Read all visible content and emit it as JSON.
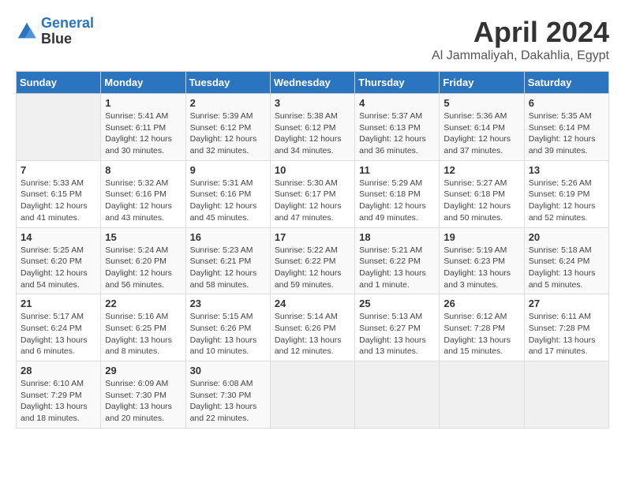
{
  "logo": {
    "line1": "General",
    "line2": "Blue"
  },
  "title": "April 2024",
  "subtitle": "Al Jammaliyah, Dakahlia, Egypt",
  "headers": [
    "Sunday",
    "Monday",
    "Tuesday",
    "Wednesday",
    "Thursday",
    "Friday",
    "Saturday"
  ],
  "weeks": [
    [
      {
        "num": "",
        "detail": ""
      },
      {
        "num": "1",
        "detail": "Sunrise: 5:41 AM\nSunset: 6:11 PM\nDaylight: 12 hours\nand 30 minutes."
      },
      {
        "num": "2",
        "detail": "Sunrise: 5:39 AM\nSunset: 6:12 PM\nDaylight: 12 hours\nand 32 minutes."
      },
      {
        "num": "3",
        "detail": "Sunrise: 5:38 AM\nSunset: 6:12 PM\nDaylight: 12 hours\nand 34 minutes."
      },
      {
        "num": "4",
        "detail": "Sunrise: 5:37 AM\nSunset: 6:13 PM\nDaylight: 12 hours\nand 36 minutes."
      },
      {
        "num": "5",
        "detail": "Sunrise: 5:36 AM\nSunset: 6:14 PM\nDaylight: 12 hours\nand 37 minutes."
      },
      {
        "num": "6",
        "detail": "Sunrise: 5:35 AM\nSunset: 6:14 PM\nDaylight: 12 hours\nand 39 minutes."
      }
    ],
    [
      {
        "num": "7",
        "detail": "Sunrise: 5:33 AM\nSunset: 6:15 PM\nDaylight: 12 hours\nand 41 minutes."
      },
      {
        "num": "8",
        "detail": "Sunrise: 5:32 AM\nSunset: 6:16 PM\nDaylight: 12 hours\nand 43 minutes."
      },
      {
        "num": "9",
        "detail": "Sunrise: 5:31 AM\nSunset: 6:16 PM\nDaylight: 12 hours\nand 45 minutes."
      },
      {
        "num": "10",
        "detail": "Sunrise: 5:30 AM\nSunset: 6:17 PM\nDaylight: 12 hours\nand 47 minutes."
      },
      {
        "num": "11",
        "detail": "Sunrise: 5:29 AM\nSunset: 6:18 PM\nDaylight: 12 hours\nand 49 minutes."
      },
      {
        "num": "12",
        "detail": "Sunrise: 5:27 AM\nSunset: 6:18 PM\nDaylight: 12 hours\nand 50 minutes."
      },
      {
        "num": "13",
        "detail": "Sunrise: 5:26 AM\nSunset: 6:19 PM\nDaylight: 12 hours\nand 52 minutes."
      }
    ],
    [
      {
        "num": "14",
        "detail": "Sunrise: 5:25 AM\nSunset: 6:20 PM\nDaylight: 12 hours\nand 54 minutes."
      },
      {
        "num": "15",
        "detail": "Sunrise: 5:24 AM\nSunset: 6:20 PM\nDaylight: 12 hours\nand 56 minutes."
      },
      {
        "num": "16",
        "detail": "Sunrise: 5:23 AM\nSunset: 6:21 PM\nDaylight: 12 hours\nand 58 minutes."
      },
      {
        "num": "17",
        "detail": "Sunrise: 5:22 AM\nSunset: 6:22 PM\nDaylight: 12 hours\nand 59 minutes."
      },
      {
        "num": "18",
        "detail": "Sunrise: 5:21 AM\nSunset: 6:22 PM\nDaylight: 13 hours\nand 1 minute."
      },
      {
        "num": "19",
        "detail": "Sunrise: 5:19 AM\nSunset: 6:23 PM\nDaylight: 13 hours\nand 3 minutes."
      },
      {
        "num": "20",
        "detail": "Sunrise: 5:18 AM\nSunset: 6:24 PM\nDaylight: 13 hours\nand 5 minutes."
      }
    ],
    [
      {
        "num": "21",
        "detail": "Sunrise: 5:17 AM\nSunset: 6:24 PM\nDaylight: 13 hours\nand 6 minutes."
      },
      {
        "num": "22",
        "detail": "Sunrise: 5:16 AM\nSunset: 6:25 PM\nDaylight: 13 hours\nand 8 minutes."
      },
      {
        "num": "23",
        "detail": "Sunrise: 5:15 AM\nSunset: 6:26 PM\nDaylight: 13 hours\nand 10 minutes."
      },
      {
        "num": "24",
        "detail": "Sunrise: 5:14 AM\nSunset: 6:26 PM\nDaylight: 13 hours\nand 12 minutes."
      },
      {
        "num": "25",
        "detail": "Sunrise: 5:13 AM\nSunset: 6:27 PM\nDaylight: 13 hours\nand 13 minutes."
      },
      {
        "num": "26",
        "detail": "Sunrise: 6:12 AM\nSunset: 7:28 PM\nDaylight: 13 hours\nand 15 minutes."
      },
      {
        "num": "27",
        "detail": "Sunrise: 6:11 AM\nSunset: 7:28 PM\nDaylight: 13 hours\nand 17 minutes."
      }
    ],
    [
      {
        "num": "28",
        "detail": "Sunrise: 6:10 AM\nSunset: 7:29 PM\nDaylight: 13 hours\nand 18 minutes."
      },
      {
        "num": "29",
        "detail": "Sunrise: 6:09 AM\nSunset: 7:30 PM\nDaylight: 13 hours\nand 20 minutes."
      },
      {
        "num": "30",
        "detail": "Sunrise: 6:08 AM\nSunset: 7:30 PM\nDaylight: 13 hours\nand 22 minutes."
      },
      {
        "num": "",
        "detail": ""
      },
      {
        "num": "",
        "detail": ""
      },
      {
        "num": "",
        "detail": ""
      },
      {
        "num": "",
        "detail": ""
      }
    ]
  ]
}
